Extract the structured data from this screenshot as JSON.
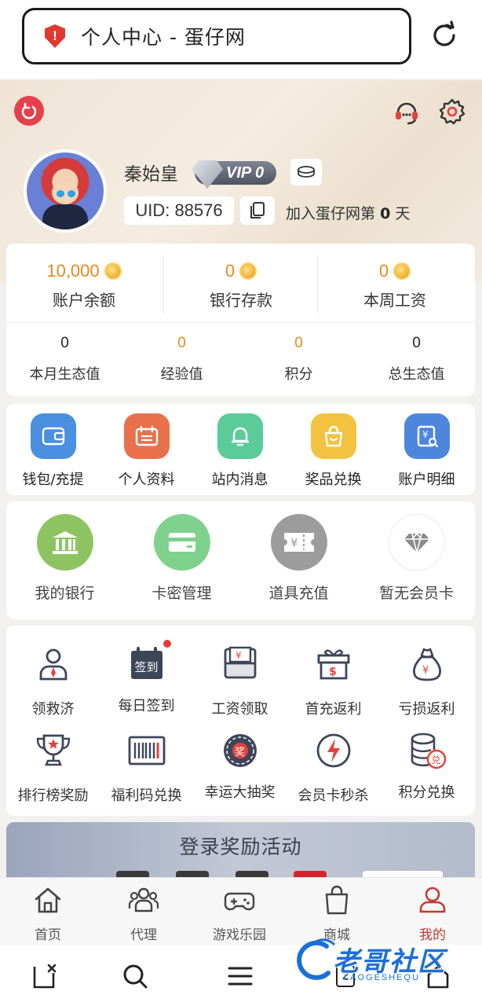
{
  "browser": {
    "title": "个人中心 - 蛋仔网",
    "tab_count": "2"
  },
  "profile": {
    "username": "秦始皇",
    "vip": "VIP 0",
    "uid": "UID: 88576",
    "join_prefix": "加入蛋仔网第",
    "join_days": "0",
    "join_suffix": "天"
  },
  "stats_top": [
    {
      "value": "10,000",
      "label": "账户余额"
    },
    {
      "value": "0",
      "label": "银行存款"
    },
    {
      "value": "0",
      "label": "本周工资"
    }
  ],
  "stats_bottom": [
    {
      "value": "0",
      "label": "本月生态值"
    },
    {
      "value": "0",
      "label": "经验值"
    },
    {
      "value": "0",
      "label": "积分"
    },
    {
      "value": "0",
      "label": "总生态值"
    }
  ],
  "shortcuts": [
    {
      "label": "钱包/充提",
      "icon": "wallet-icon"
    },
    {
      "label": "个人资料",
      "icon": "profile-card-icon"
    },
    {
      "label": "站内消息",
      "icon": "bell-icon"
    },
    {
      "label": "奖品兑换",
      "icon": "shopping-bag-icon"
    },
    {
      "label": "账户明细",
      "icon": "statement-icon"
    }
  ],
  "bank_items": [
    {
      "label": "我的银行",
      "icon": "bank-icon"
    },
    {
      "label": "卡密管理",
      "icon": "card-icon"
    },
    {
      "label": "道具充值",
      "icon": "ticket-icon"
    },
    {
      "label": "暂无会员卡",
      "icon": "diamond-icon"
    }
  ],
  "features": [
    {
      "label": "领救济",
      "icon": "person-icon"
    },
    {
      "label": "每日签到",
      "icon": "calendar-signin-icon",
      "badge_text": "签到"
    },
    {
      "label": "工资领取",
      "icon": "salary-envelope-icon"
    },
    {
      "label": "首充返利",
      "icon": "gift-box-icon"
    },
    {
      "label": "亏损返利",
      "icon": "money-bag-icon"
    },
    {
      "label": "排行榜奖励",
      "icon": "trophy-icon"
    },
    {
      "label": "福利码兑换",
      "icon": "barcode-icon"
    },
    {
      "label": "幸运大抽奖",
      "icon": "lucky-wheel-icon",
      "badge_text": "奖"
    },
    {
      "label": "会员卡秒杀",
      "icon": "flash-icon"
    },
    {
      "label": "积分兑换",
      "icon": "points-exchange-icon",
      "badge_text": "兑"
    }
  ],
  "banner": {
    "title": "登录奖励活动"
  },
  "tabs": [
    {
      "label": "首页",
      "icon": "home-icon"
    },
    {
      "label": "代理",
      "icon": "agents-icon"
    },
    {
      "label": "游戏乐园",
      "icon": "gamepad-icon"
    },
    {
      "label": "商城",
      "icon": "shop-bag-icon"
    },
    {
      "label": "我的",
      "icon": "user-icon"
    }
  ],
  "watermark": {
    "text": "老哥社区",
    "sub": "LAOGESHEQU"
  },
  "colors": {
    "accent": "#c43a2f",
    "coin": "#e48a1c",
    "wallet": "#4a8fe0",
    "profile": "#e8714b",
    "message": "#5ccb9a",
    "prize": "#f2c341",
    "statement": "#4e86dd",
    "bank": "#8dc461",
    "card": "#7fd28d",
    "ticket": "#9c9c9c"
  }
}
